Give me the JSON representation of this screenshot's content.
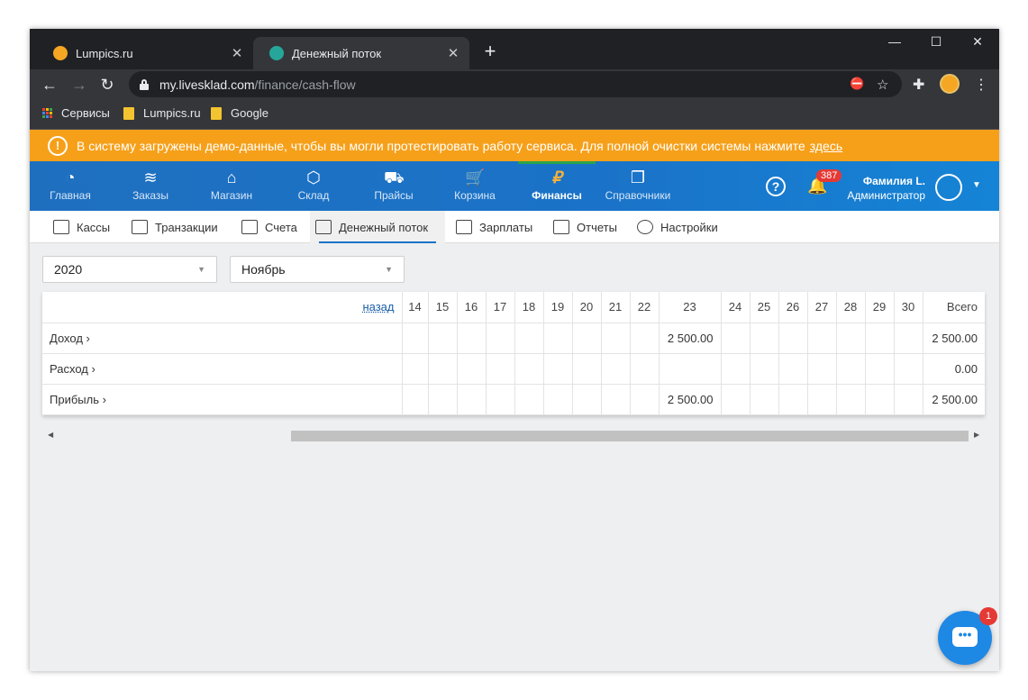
{
  "browser": {
    "tabs": [
      {
        "title": "Lumpics.ru",
        "favicon_color": "#f5a623",
        "icon": "lumpics-favicon"
      },
      {
        "title": "Денежный поток",
        "favicon_color": "#26a69a",
        "icon": "livesklad-favicon"
      }
    ],
    "close_symbol": "✕",
    "new_tab_symbol": "+",
    "window_controls": {
      "minimize": "—",
      "maximize": "☐",
      "close": "✕"
    },
    "nav": {
      "back": "←",
      "forward": "→",
      "reload": "↻"
    },
    "url_host": "my.livesklad.com",
    "url_path": "/finance/cash-flow",
    "bookmarks": [
      {
        "label": "Сервисы",
        "icon": "apps-grid-icon"
      },
      {
        "label": "Lumpics.ru",
        "icon": "folder-icon"
      },
      {
        "label": "Google",
        "icon": "folder-icon"
      }
    ]
  },
  "banner": {
    "icon": "!",
    "text": "В систему загружены демо-данные, чтобы вы могли протестировать работу сервиса. Для полной очистки системы нажмите",
    "link": "здесь",
    "color": "#f6a01a"
  },
  "app_nav": {
    "items": [
      {
        "label": "Главная",
        "icon": "◔"
      },
      {
        "label": "Заказы",
        "icon": "≋"
      },
      {
        "label": "Магазин",
        "icon": "⌂"
      },
      {
        "label": "Склад",
        "icon": "⬡"
      },
      {
        "label": "Прайсы",
        "icon": "⛟"
      },
      {
        "label": "Корзина",
        "icon": "🛒"
      },
      {
        "label": "Финансы",
        "icon": "₽"
      },
      {
        "label": "Справочники",
        "icon": "❐"
      }
    ],
    "active": "Финансы",
    "help_symbol": "?",
    "bell_symbol": "🔔",
    "notifications": "387",
    "user_name": "Фамилия L.",
    "user_role": "Администратор",
    "caret": "▼"
  },
  "sub_nav": {
    "items": [
      {
        "label": "Кассы"
      },
      {
        "label": "Транзакции"
      },
      {
        "label": "Счета"
      },
      {
        "label": "Денежный поток"
      },
      {
        "label": "Зарплаты"
      },
      {
        "label": "Отчеты"
      },
      {
        "label": "Настройки"
      }
    ],
    "active": "Денежный поток"
  },
  "filters": {
    "year": "2020",
    "month": "Ноябрь",
    "dropdown_symbol": "▼"
  },
  "cashflow": {
    "back_link": "назад",
    "days": [
      "14",
      "15",
      "16",
      "17",
      "18",
      "19",
      "20",
      "21",
      "22",
      "23",
      "24",
      "25",
      "26",
      "27",
      "28",
      "29",
      "30"
    ],
    "total_header": "Всего",
    "rows": [
      {
        "label": "Доход",
        "arrow": "›",
        "day23": "2 500.00",
        "total": "2 500.00"
      },
      {
        "label": "Расход",
        "arrow": "›",
        "day23": "",
        "total": "0.00"
      },
      {
        "label": "Прибыль",
        "arrow": "›",
        "day23": "2 500.00",
        "total": "2 500.00"
      }
    ]
  },
  "scroll": {
    "left": "◀",
    "right": "▶"
  },
  "chat": {
    "icon": "•••",
    "unread": "1"
  }
}
